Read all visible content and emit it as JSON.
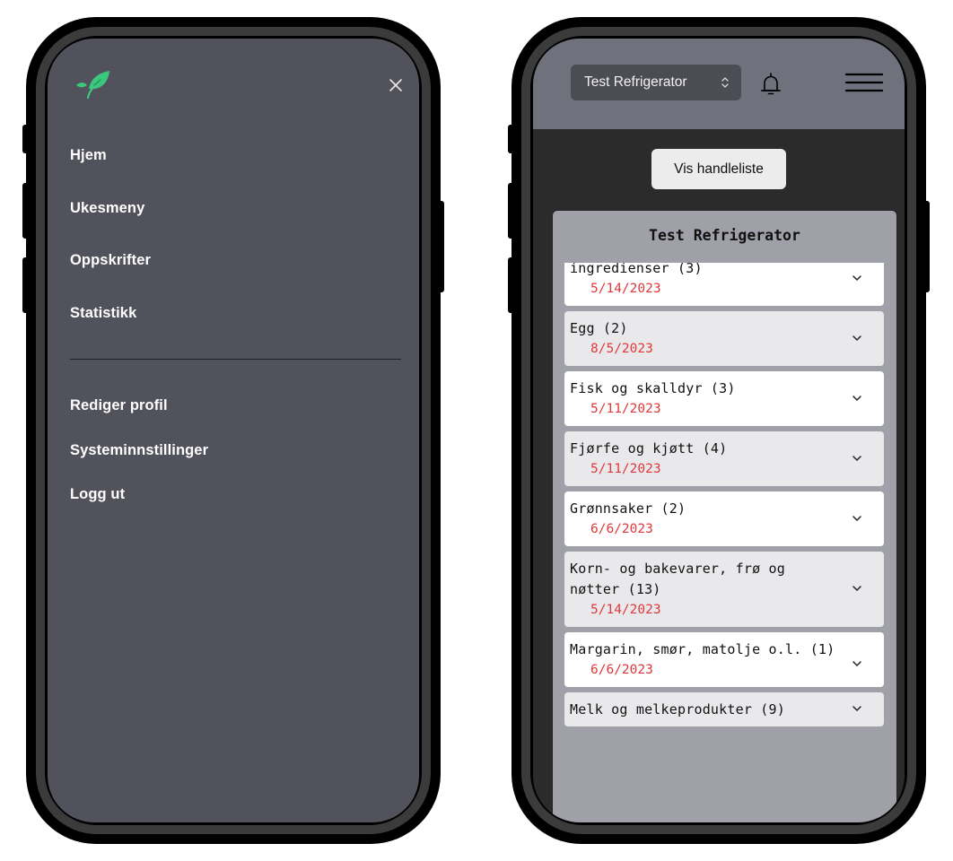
{
  "menu": {
    "logo": "leaf-logo",
    "close_icon": "close-icon",
    "items": [
      {
        "label": "Hjem"
      },
      {
        "label": "Ukesmeny"
      },
      {
        "label": "Oppskrifter"
      },
      {
        "label": "Statistikk"
      }
    ],
    "account_items": [
      {
        "label": "Rediger profil"
      },
      {
        "label": "Systeminnstillinger"
      },
      {
        "label": "Logg ut"
      }
    ]
  },
  "app": {
    "fridge_select": {
      "value": "Test Refrigerator"
    },
    "icons": [
      "bell-icon",
      "hamburger-menu-icon"
    ],
    "shopping_list_button": "Vis handleliste",
    "panel_title": "Test Refrigerator",
    "categories": [
      {
        "name": "ingredienser (3)",
        "date": "5/14/2023"
      },
      {
        "name": "Egg (2)",
        "date": "8/5/2023"
      },
      {
        "name": "Fisk og skalldyr (3)",
        "date": "5/11/2023"
      },
      {
        "name": "Fjørfe og kjøtt (4)",
        "date": "5/11/2023"
      },
      {
        "name": "Grønnsaker (2)",
        "date": "6/6/2023"
      },
      {
        "name": "Korn- og bakevarer, frø og nøtter (13)",
        "date": "5/14/2023"
      },
      {
        "name": "Margarin, smør, matolje o.l. (1)",
        "date": "6/6/2023"
      },
      {
        "name": "Melk og melkeprodukter (9)",
        "date": ""
      }
    ]
  },
  "colors": {
    "menu_bg": "#51525b",
    "topbar_bg": "#6f717c",
    "accent_green": "#3cc77f",
    "date_red": "#e0383b"
  }
}
